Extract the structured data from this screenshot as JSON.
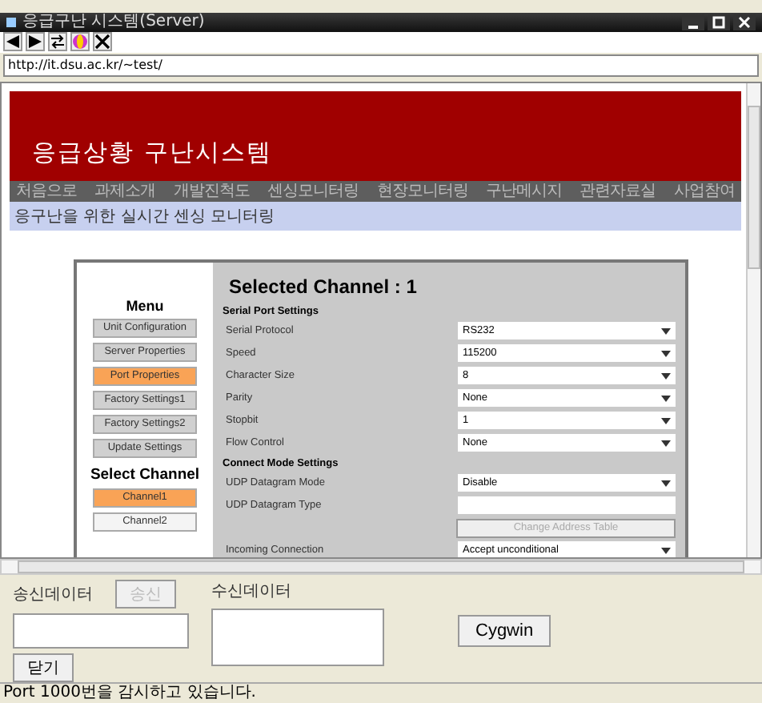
{
  "window": {
    "title": "응급구난 시스템(Server)"
  },
  "address": "http://it.dsu.ac.kr/~test/",
  "header": {
    "title": "응급상황 구난시스템"
  },
  "nav": [
    "처음으로",
    "과제소개",
    "개발진척도",
    "센싱모니터링",
    "현장모니터링",
    "구난메시지",
    "관련자료실",
    "사업참여"
  ],
  "subtitle": "응구난을 위한 실시간 센싱 모니터링",
  "menu": {
    "heading": "Menu",
    "items": [
      {
        "label": "Unit Configuration",
        "selected": false
      },
      {
        "label": "Server Properties",
        "selected": false
      },
      {
        "label": "Port Properties",
        "selected": true
      },
      {
        "label": "Factory Settings1",
        "selected": false
      },
      {
        "label": "Factory Settings2",
        "selected": false
      },
      {
        "label": "Update Settings",
        "selected": false
      }
    ]
  },
  "channel_menu": {
    "heading": "Select Channel",
    "items": [
      {
        "label": "Channel1",
        "selected": true
      },
      {
        "label": "Channel2",
        "selected": false
      }
    ]
  },
  "panel": {
    "title": "Selected Channel : 1",
    "rows": [
      {
        "kind": "heading",
        "label": "Serial Port Settings"
      },
      {
        "kind": "select",
        "label": "Serial Protocol",
        "value": "RS232"
      },
      {
        "kind": "select",
        "label": "Speed",
        "value": "115200"
      },
      {
        "kind": "select",
        "label": "Character Size",
        "value": "8"
      },
      {
        "kind": "select",
        "label": "Parity",
        "value": "None"
      },
      {
        "kind": "select",
        "label": "Stopbit",
        "value": "1"
      },
      {
        "kind": "select",
        "label": "Flow Control",
        "value": "None"
      },
      {
        "kind": "heading",
        "label": "Connect Mode Settings"
      },
      {
        "kind": "select",
        "label": "UDP Datagram Mode",
        "value": "Disable"
      },
      {
        "kind": "input",
        "label": "UDP Datagram Type"
      },
      {
        "kind": "button",
        "label": "Change Address Table"
      },
      {
        "kind": "select",
        "label": "Incoming Connection",
        "value": "Accept unconditional"
      }
    ]
  },
  "send": {
    "label": "송신데이터",
    "button": {
      "label": "송신",
      "disabled": true
    }
  },
  "receive": {
    "label": "수신데이터"
  },
  "close_button": "닫기",
  "cygwin_button": "Cygwin",
  "status": "Port 1000번을 감시하고 있습니다."
}
